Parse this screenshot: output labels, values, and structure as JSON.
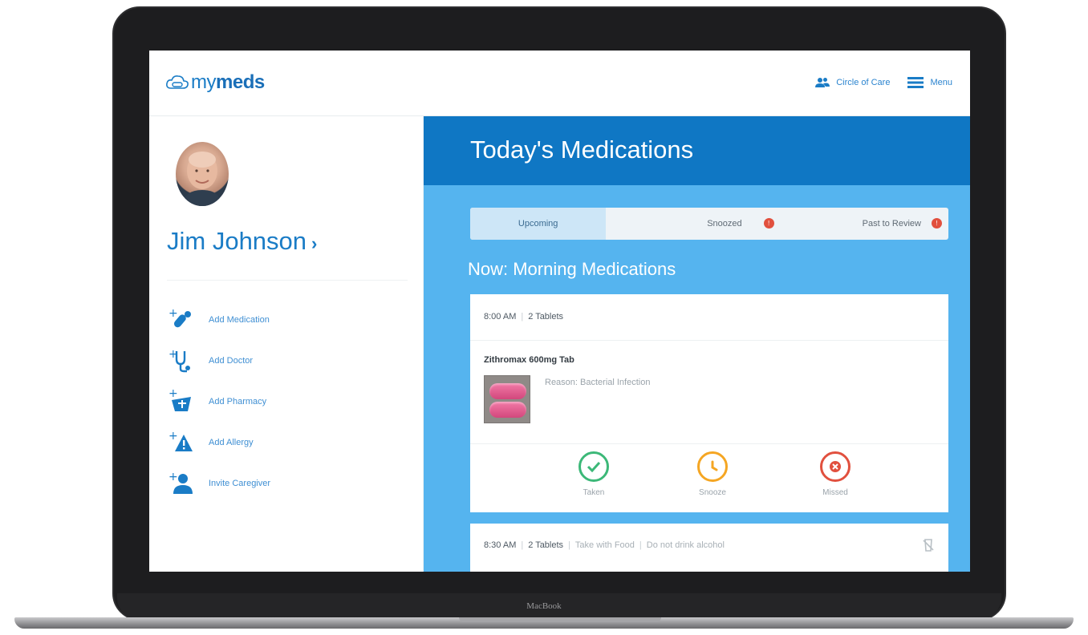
{
  "device": {
    "brand": "MacBook"
  },
  "app": {
    "logo_text_light": "my",
    "logo_text_bold": "meds"
  },
  "nav": {
    "circle_of_care": "Circle of Care",
    "menu": "Menu"
  },
  "user": {
    "name": "Jim Johnson"
  },
  "sidebar": {
    "actions": [
      {
        "label": "Add Medication",
        "icon": "add-medication-icon"
      },
      {
        "label": "Add Doctor",
        "icon": "add-doctor-icon"
      },
      {
        "label": "Add Pharmacy",
        "icon": "add-pharmacy-icon"
      },
      {
        "label": "Add Allergy",
        "icon": "add-allergy-icon"
      },
      {
        "label": "Invite Caregiver",
        "icon": "invite-caregiver-icon"
      }
    ]
  },
  "main": {
    "title": "Today's Medications",
    "tabs": [
      {
        "label": "Upcoming",
        "active": true
      },
      {
        "label": "Snoozed",
        "badge": "!"
      },
      {
        "label": "Past to Review",
        "badge": "!"
      }
    ],
    "section_title": "Now: Morning Medications",
    "dose_card": {
      "time": "8:00 AM",
      "quantity": "2 Tablets",
      "drug_name": "Zithromax 600mg Tab",
      "reason": "Reason: Bacterial Infection",
      "actions": [
        {
          "label": "Taken",
          "color": "#3cb878",
          "icon": "check-icon"
        },
        {
          "label": "Snooze",
          "color": "#f5a623",
          "icon": "clock-icon"
        },
        {
          "label": "Missed",
          "color": "#e1503e",
          "icon": "x-icon"
        }
      ]
    },
    "next_card": {
      "time": "8:30 AM",
      "quantity": "2 Tablets",
      "note1": "Take with Food",
      "note2": "Do not drink alcohol"
    }
  },
  "colors": {
    "primary": "#0f77c4",
    "panel": "#55b4ef",
    "accent_text": "#1a7cc6",
    "badge": "#e1503e"
  }
}
